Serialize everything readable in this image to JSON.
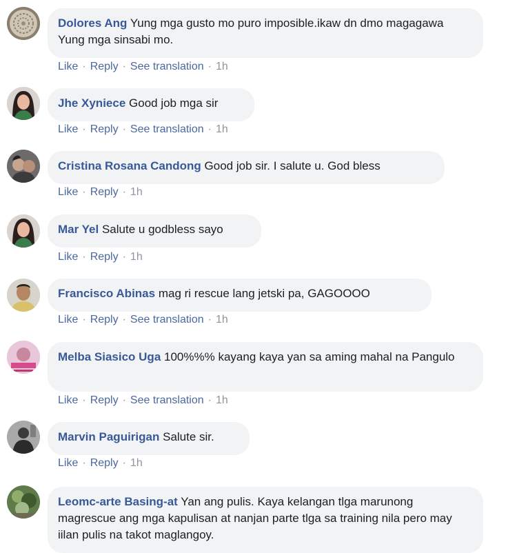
{
  "actions": {
    "like": "Like",
    "reply": "Reply",
    "see_translation": "See translation",
    "separator": "·"
  },
  "comments": [
    {
      "author": "Dolores Ang",
      "text": "Yung mga gusto mo puro imposible.ikaw dn dmo magagawa Yung mga sinsabi mo.",
      "time": "1h",
      "has_translation": true,
      "avatar_icon": "lace-doily-avatar"
    },
    {
      "author": "Jhe Xyniece",
      "text": "Good job mga sir",
      "time": "1h",
      "has_translation": true,
      "avatar_icon": "woman-portrait-avatar"
    },
    {
      "author": "Cristina Rosana Candong",
      "text": "Good job sir. I salute u. God bless",
      "time": "1h",
      "has_translation": false,
      "avatar_icon": "selfie-avatar"
    },
    {
      "author": "Mar Yel",
      "text": "Salute u godbless sayo",
      "time": "1h",
      "has_translation": false,
      "avatar_icon": "woman-portrait-avatar"
    },
    {
      "author": "Francisco Abinas",
      "text": "mag ri rescue lang jetski pa, GAGOOOO",
      "time": "1h",
      "has_translation": true,
      "avatar_icon": "man-portrait-avatar"
    },
    {
      "author": "Melba Siasico Uga",
      "text": "100%%% kayang kaya yan sa aming mahal na Pangulo",
      "time": "1h",
      "has_translation": true,
      "avatar_icon": "pink-photo-avatar"
    },
    {
      "author": "Marvin Paguirigan",
      "text": "Salute sir.",
      "time": "1h",
      "has_translation": false,
      "avatar_icon": "silhouette-avatar"
    },
    {
      "author": "Leomc-arte Basing-at",
      "text": "Yan ang pulis. Kaya kelangan tlga marunong magrescue ang mga kapulisan at nanjan parte tlga sa training nila pero may iilan pulis na takot maglangoy.",
      "time": "",
      "has_translation": false,
      "avatar_icon": "garden-photo-avatar"
    }
  ]
}
